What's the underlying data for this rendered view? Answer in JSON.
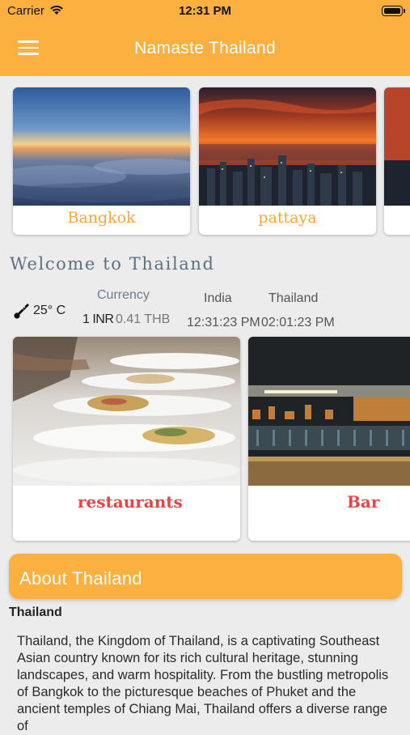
{
  "status_bar": {
    "carrier": "Carrier",
    "time": "12:31 PM"
  },
  "header": {
    "title": "Namaste Thailand"
  },
  "cities": [
    {
      "label": "Bangkok"
    },
    {
      "label": "pattaya"
    }
  ],
  "welcome": {
    "title": "Welcome to Thailand"
  },
  "weather": {
    "temperature": "25° C"
  },
  "currency": {
    "label": "Currency",
    "inr": "1 INR",
    "thb": "0.41 THB"
  },
  "clocks": {
    "india_label": "India",
    "thailand_label": "Thailand",
    "india_time": "12:31:23 PM",
    "thailand_time": "02:01:23 PM"
  },
  "categories": [
    {
      "label": "restaurants"
    },
    {
      "label": "Bar"
    }
  ],
  "about": {
    "title": "About Thailand",
    "subtitle": "Thailand",
    "body": "Thailand, the Kingdom of Thailand, is a captivating Southeast Asian country known for its rich cultural heritage, stunning landscapes, and warm hospitality. From the bustling metropolis of Bangkok to the picturesque beaches of Phuket and the ancient temples of Chiang Mai, Thailand offers a diverse range of"
  },
  "colors": {
    "accent": "#fbb040",
    "city_label": "#f9a73b",
    "category_label": "#e14747"
  }
}
